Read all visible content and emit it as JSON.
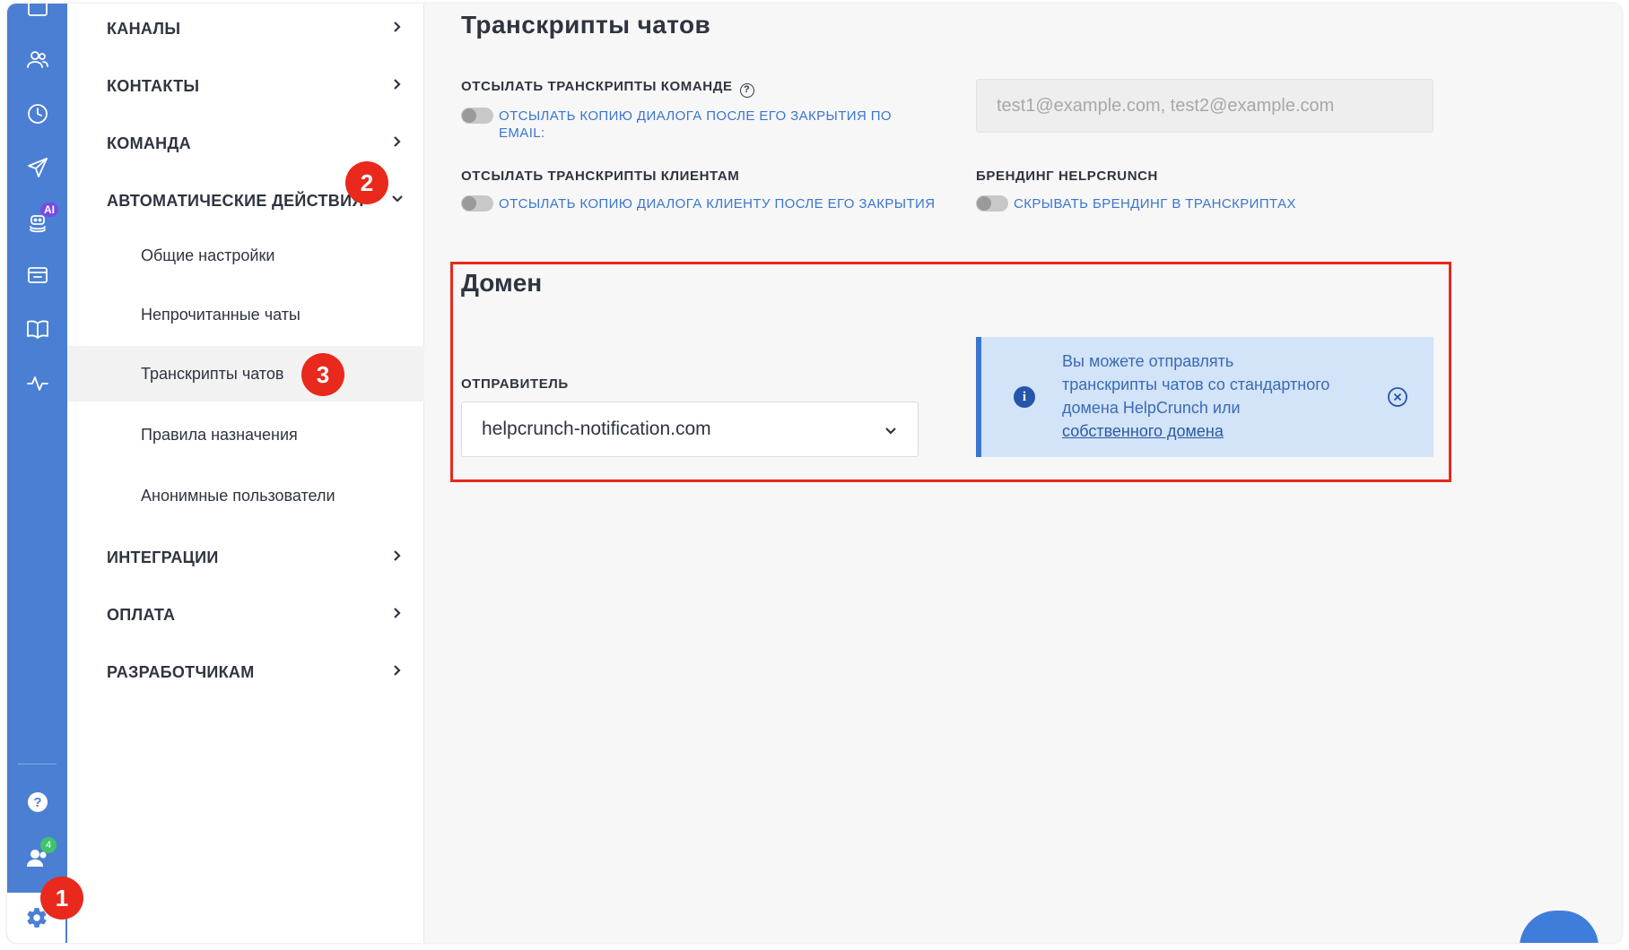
{
  "menu": {
    "channels": "КАНАЛЫ",
    "contacts": "КОНТАКТЫ",
    "team": "КОМАНДА",
    "automation": "АВТОМАТИЧЕСКИЕ ДЕЙСТВИЯ",
    "automation_items": {
      "general": "Общие настройки",
      "unread": "Непрочитанные чаты",
      "transcripts": "Транскрипты чатов",
      "assignment": "Правила назначения",
      "anonymous": "Анонимные пользователи"
    },
    "integrations": "ИНТЕГРАЦИИ",
    "billing": "ОПЛАТА",
    "developers": "РАЗРАБОТЧИКАМ"
  },
  "rail": {
    "ai_badge": "AI",
    "team_count": "4",
    "accent": "#4a7fd4"
  },
  "markers": {
    "m1": "1",
    "m2": "2",
    "m3": "3",
    "color": "#e8291c"
  },
  "transcripts": {
    "title": "Транскрипты чатов",
    "team_label": "ОТСЫЛАТЬ ТРАНСКРИПТЫ КОМАНДЕ",
    "team_toggle_text": "ОТСЫЛАТЬ КОПИЮ ДИАЛОГА ПОСЛЕ ЕГО ЗАКРЫТИЯ ПО EMAIL:",
    "emails_placeholder": "test1@example.com, test2@example.com",
    "clients_label": "ОТСЫЛАТЬ ТРАНСКРИПТЫ КЛИЕНТАМ",
    "clients_toggle_text": "ОТСЫЛАТЬ КОПИЮ ДИАЛОГА КЛИЕНТУ ПОСЛЕ ЕГО ЗАКРЫТИЯ",
    "branding_label": "БРЕНДИНГ HELPCRUNCH",
    "branding_toggle_text": "СКРЫВАТЬ БРЕНДИНГ В ТРАНСКРИПТАХ"
  },
  "domain": {
    "title": "Домен",
    "sender_label": "ОТПРАВИТЕЛЬ",
    "sender_value": "helpcrunch-notification.com",
    "info_text": "Вы можете отправлять транскрипты чатов со стандартного домена HelpCrunch или ",
    "info_link": "собственного домена"
  }
}
